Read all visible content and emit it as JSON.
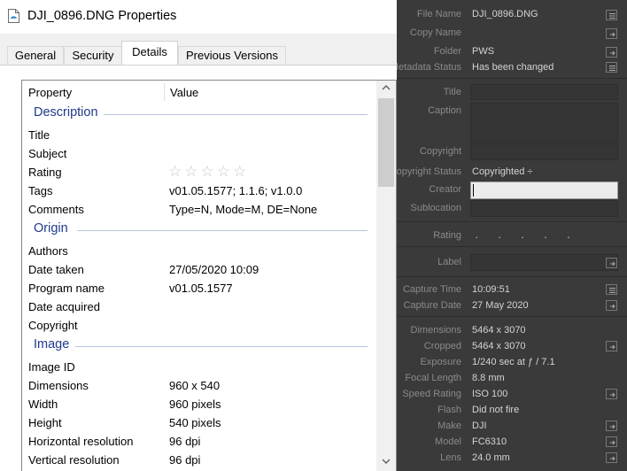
{
  "window": {
    "title": "DJI_0896.DNG Properties"
  },
  "tabs": [
    {
      "label": "General"
    },
    {
      "label": "Security"
    },
    {
      "label": "Details"
    },
    {
      "label": "Previous Versions"
    }
  ],
  "details": {
    "header": {
      "property": "Property",
      "value": "Value"
    },
    "groups": {
      "description": {
        "label": "Description",
        "rows": [
          {
            "name": "Title",
            "value": ""
          },
          {
            "name": "Subject",
            "value": ""
          },
          {
            "name": "Rating",
            "value": "",
            "stars": 0
          },
          {
            "name": "Tags",
            "value": "v01.05.1577; 1.1.6; v1.0.0"
          },
          {
            "name": "Comments",
            "value": "Type=N, Mode=M, DE=None"
          }
        ]
      },
      "origin": {
        "label": "Origin",
        "rows": [
          {
            "name": "Authors",
            "value": ""
          },
          {
            "name": "Date taken",
            "value": "27/05/2020 10:09"
          },
          {
            "name": "Program name",
            "value": "v01.05.1577"
          },
          {
            "name": "Date acquired",
            "value": ""
          },
          {
            "name": "Copyright",
            "value": ""
          }
        ]
      },
      "image": {
        "label": "Image",
        "rows": [
          {
            "name": "Image ID",
            "value": ""
          },
          {
            "name": "Dimensions",
            "value": "960 x 540"
          },
          {
            "name": "Width",
            "value": "960 pixels"
          },
          {
            "name": "Height",
            "value": "540 pixels"
          },
          {
            "name": "Horizontal resolution",
            "value": "96 dpi"
          },
          {
            "name": "Vertical resolution",
            "value": "96 dpi"
          }
        ]
      }
    }
  },
  "metadata_panel": {
    "file_name": {
      "label": "File Name",
      "value": "DJI_0896.DNG"
    },
    "copy_name": {
      "label": "Copy Name",
      "value": ""
    },
    "folder": {
      "label": "Folder",
      "value": "PWS"
    },
    "metadata_status": {
      "label": "Metadata Status",
      "value": "Has been changed"
    },
    "title": {
      "label": "Title",
      "value": ""
    },
    "caption": {
      "label": "Caption",
      "value": ""
    },
    "copyright": {
      "label": "Copyright",
      "value": ""
    },
    "copyright_status": {
      "label": "Copyright Status",
      "value": "Copyrighted ÷"
    },
    "creator": {
      "label": "Creator",
      "value": ""
    },
    "sublocation": {
      "label": "Sublocation",
      "value": ""
    },
    "rating": {
      "label": "Rating",
      "value": "· · · · ·"
    },
    "label": {
      "label": "Label",
      "value": ""
    },
    "capture_time": {
      "label": "Capture Time",
      "value": "10:09:51"
    },
    "capture_date": {
      "label": "Capture Date",
      "value": "27 May 2020"
    },
    "dimensions": {
      "label": "Dimensions",
      "value": "5464 x 3070"
    },
    "cropped": {
      "label": "Cropped",
      "value": "5464 x 3070"
    },
    "exposure": {
      "label": "Exposure",
      "value": "1/240 sec at ƒ / 7.1"
    },
    "focal_length": {
      "label": "Focal Length",
      "value": "8.8 mm"
    },
    "speed_rating": {
      "label": "Speed Rating",
      "value": "ISO 100"
    },
    "flash": {
      "label": "Flash",
      "value": "Did not fire"
    },
    "make": {
      "label": "Make",
      "value": "DJI"
    },
    "model": {
      "label": "Model",
      "value": "FC6310"
    },
    "lens": {
      "label": "Lens",
      "value": "24.0 mm"
    }
  },
  "colors": {
    "group_heading": "#1e3a8a",
    "panel_background": "#3a3a3a",
    "panel_value": "#d4d4d4",
    "panel_label": "#8a8a8a"
  }
}
